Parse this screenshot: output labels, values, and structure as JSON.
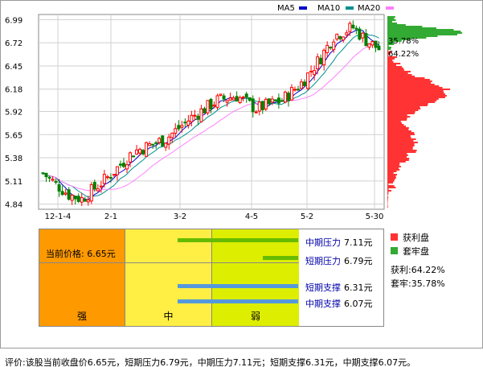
{
  "chart_data": {
    "type": "candlestick",
    "legend": [
      {
        "name": "MA5",
        "color": "#0000cc"
      },
      {
        "name": "MA10",
        "color": "#009090"
      },
      {
        "name": "MA20",
        "color": "#ff80ff"
      }
    ],
    "y_ticks": [
      "6.99",
      "6.72",
      "6.45",
      "6.18",
      "5.92",
      "5.65",
      "5.38",
      "5.11",
      "4.84"
    ],
    "x_ticks": [
      "12-1-4",
      "2-1",
      "3-2",
      "4-5",
      "5-2",
      "5-30"
    ],
    "ylim": [
      4.78,
      7.05
    ],
    "profit_pct_label": "64.22%",
    "trapped_pct_label": "35.78%",
    "colors": {
      "up": "#ff0000",
      "down": "#008000",
      "profit": "#ff3333",
      "trapped": "#33aa33"
    }
  },
  "panel": {
    "price_label": "当前价格:",
    "price_value": "6.65元",
    "zones": [
      "强",
      "中",
      "弱"
    ],
    "levels": [
      {
        "name": "中期压力",
        "value": "7.11元",
        "color": "#66bb00"
      },
      {
        "name": "短期压力",
        "value": "6.79元",
        "color": "#66bb00"
      },
      {
        "name": "短期支撑",
        "value": "6.31元",
        "color": "#5599dd"
      },
      {
        "name": "中期支撑",
        "value": "6.07元",
        "color": "#5599dd"
      }
    ]
  },
  "legend2": {
    "profit_label": "获利盘",
    "trapped_label": "套牢盘",
    "profit_text": "获利:64.22%",
    "trapped_text": "套牢:35.78%"
  },
  "comment": "评价:该股当前收盘价6.65元，短期压力6.79元，中期压力7.11元；短期支撑6.31元，中期支撑6.07元。"
}
